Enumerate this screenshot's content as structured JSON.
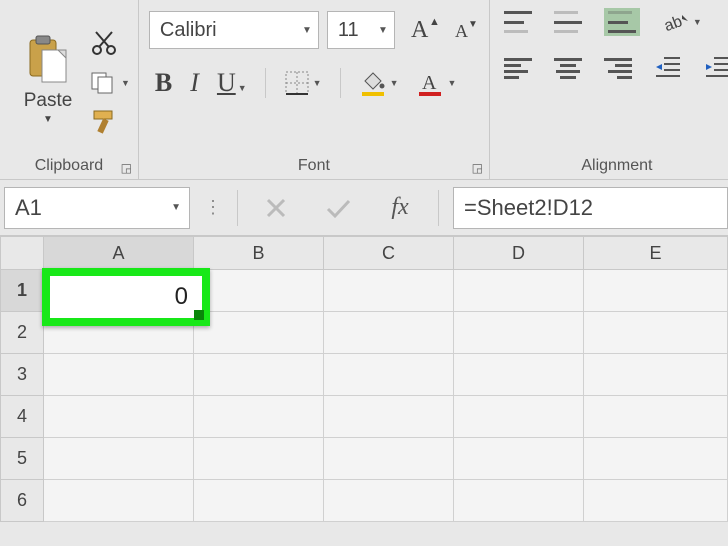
{
  "ribbon": {
    "clipboard": {
      "label": "Clipboard",
      "paste_label": "Paste"
    },
    "font": {
      "label": "Font",
      "font_name": "Calibri",
      "font_size": "11",
      "bold": "B",
      "italic": "I",
      "underline": "U"
    },
    "alignment": {
      "label": "Alignment"
    }
  },
  "formula_bar": {
    "name_box": "A1",
    "fx_label": "fx",
    "formula": "=Sheet2!D12"
  },
  "grid": {
    "columns": [
      "A",
      "B",
      "C",
      "D",
      "E"
    ],
    "rows": [
      "1",
      "2",
      "3",
      "4",
      "5",
      "6"
    ],
    "active_cell": "A1",
    "active_cell_value": "0"
  }
}
